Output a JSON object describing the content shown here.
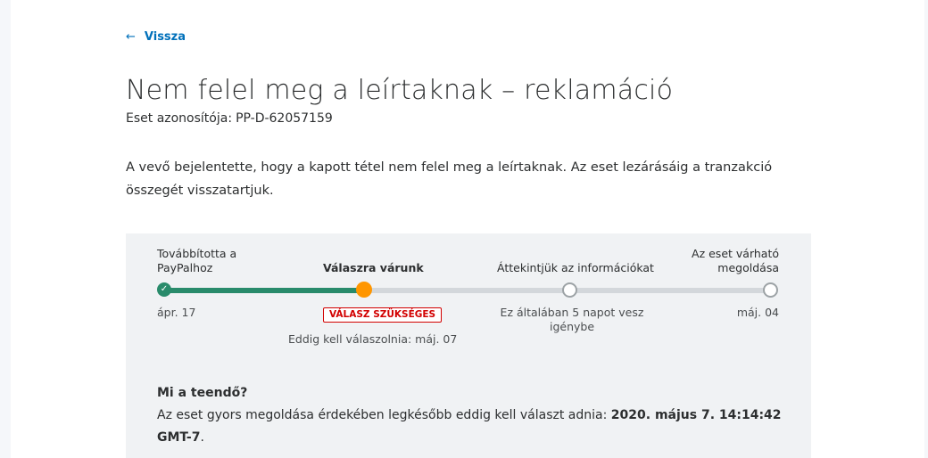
{
  "nav": {
    "back_arrow": "←",
    "back_label": "Vissza"
  },
  "header": {
    "title": "Nem felel meg a leírtaknak – reklamáció",
    "case_id_label": "Eset azonosítója:",
    "case_id_value": "PP-D-62057159"
  },
  "description": "A vevő bejelentette, hogy a kapott tétel nem felel meg a leírtaknak. Az eset lezárásáig a tranzakció összegét visszatartjuk.",
  "progress": {
    "steps": [
      {
        "label_line1": "Továbbította a",
        "label_line2": "PayPalhoz",
        "sub": "ápr. 17",
        "state": "done"
      },
      {
        "label": "Válaszra várunk",
        "badge": "VÁLASZ SZÜKSÉGES",
        "sub": "Eddig kell válaszolnia: máj. 07",
        "state": "current"
      },
      {
        "label": "Áttekintjük az információkat",
        "sub_line1": "Ez általában 5 napot vesz",
        "sub_line2": "igénybe",
        "state": "todo"
      },
      {
        "label_line1": "Az eset várható",
        "label_line2": "megoldása",
        "sub": "máj. 04",
        "state": "todo"
      }
    ],
    "colors": {
      "done": "#298b6b",
      "current": "#ff9600",
      "todo_track": "#d3d7db",
      "badge": "#d20000"
    }
  },
  "todo": {
    "title": "Mi a teendő?",
    "text_prefix": "Az eset gyors megoldása érdekében legkésőbb eddig kell választ adnia:",
    "deadline": "2020. május 7. 14:14:42 GMT-7",
    "text_suffix": "."
  },
  "icons": {
    "check": "✓"
  }
}
